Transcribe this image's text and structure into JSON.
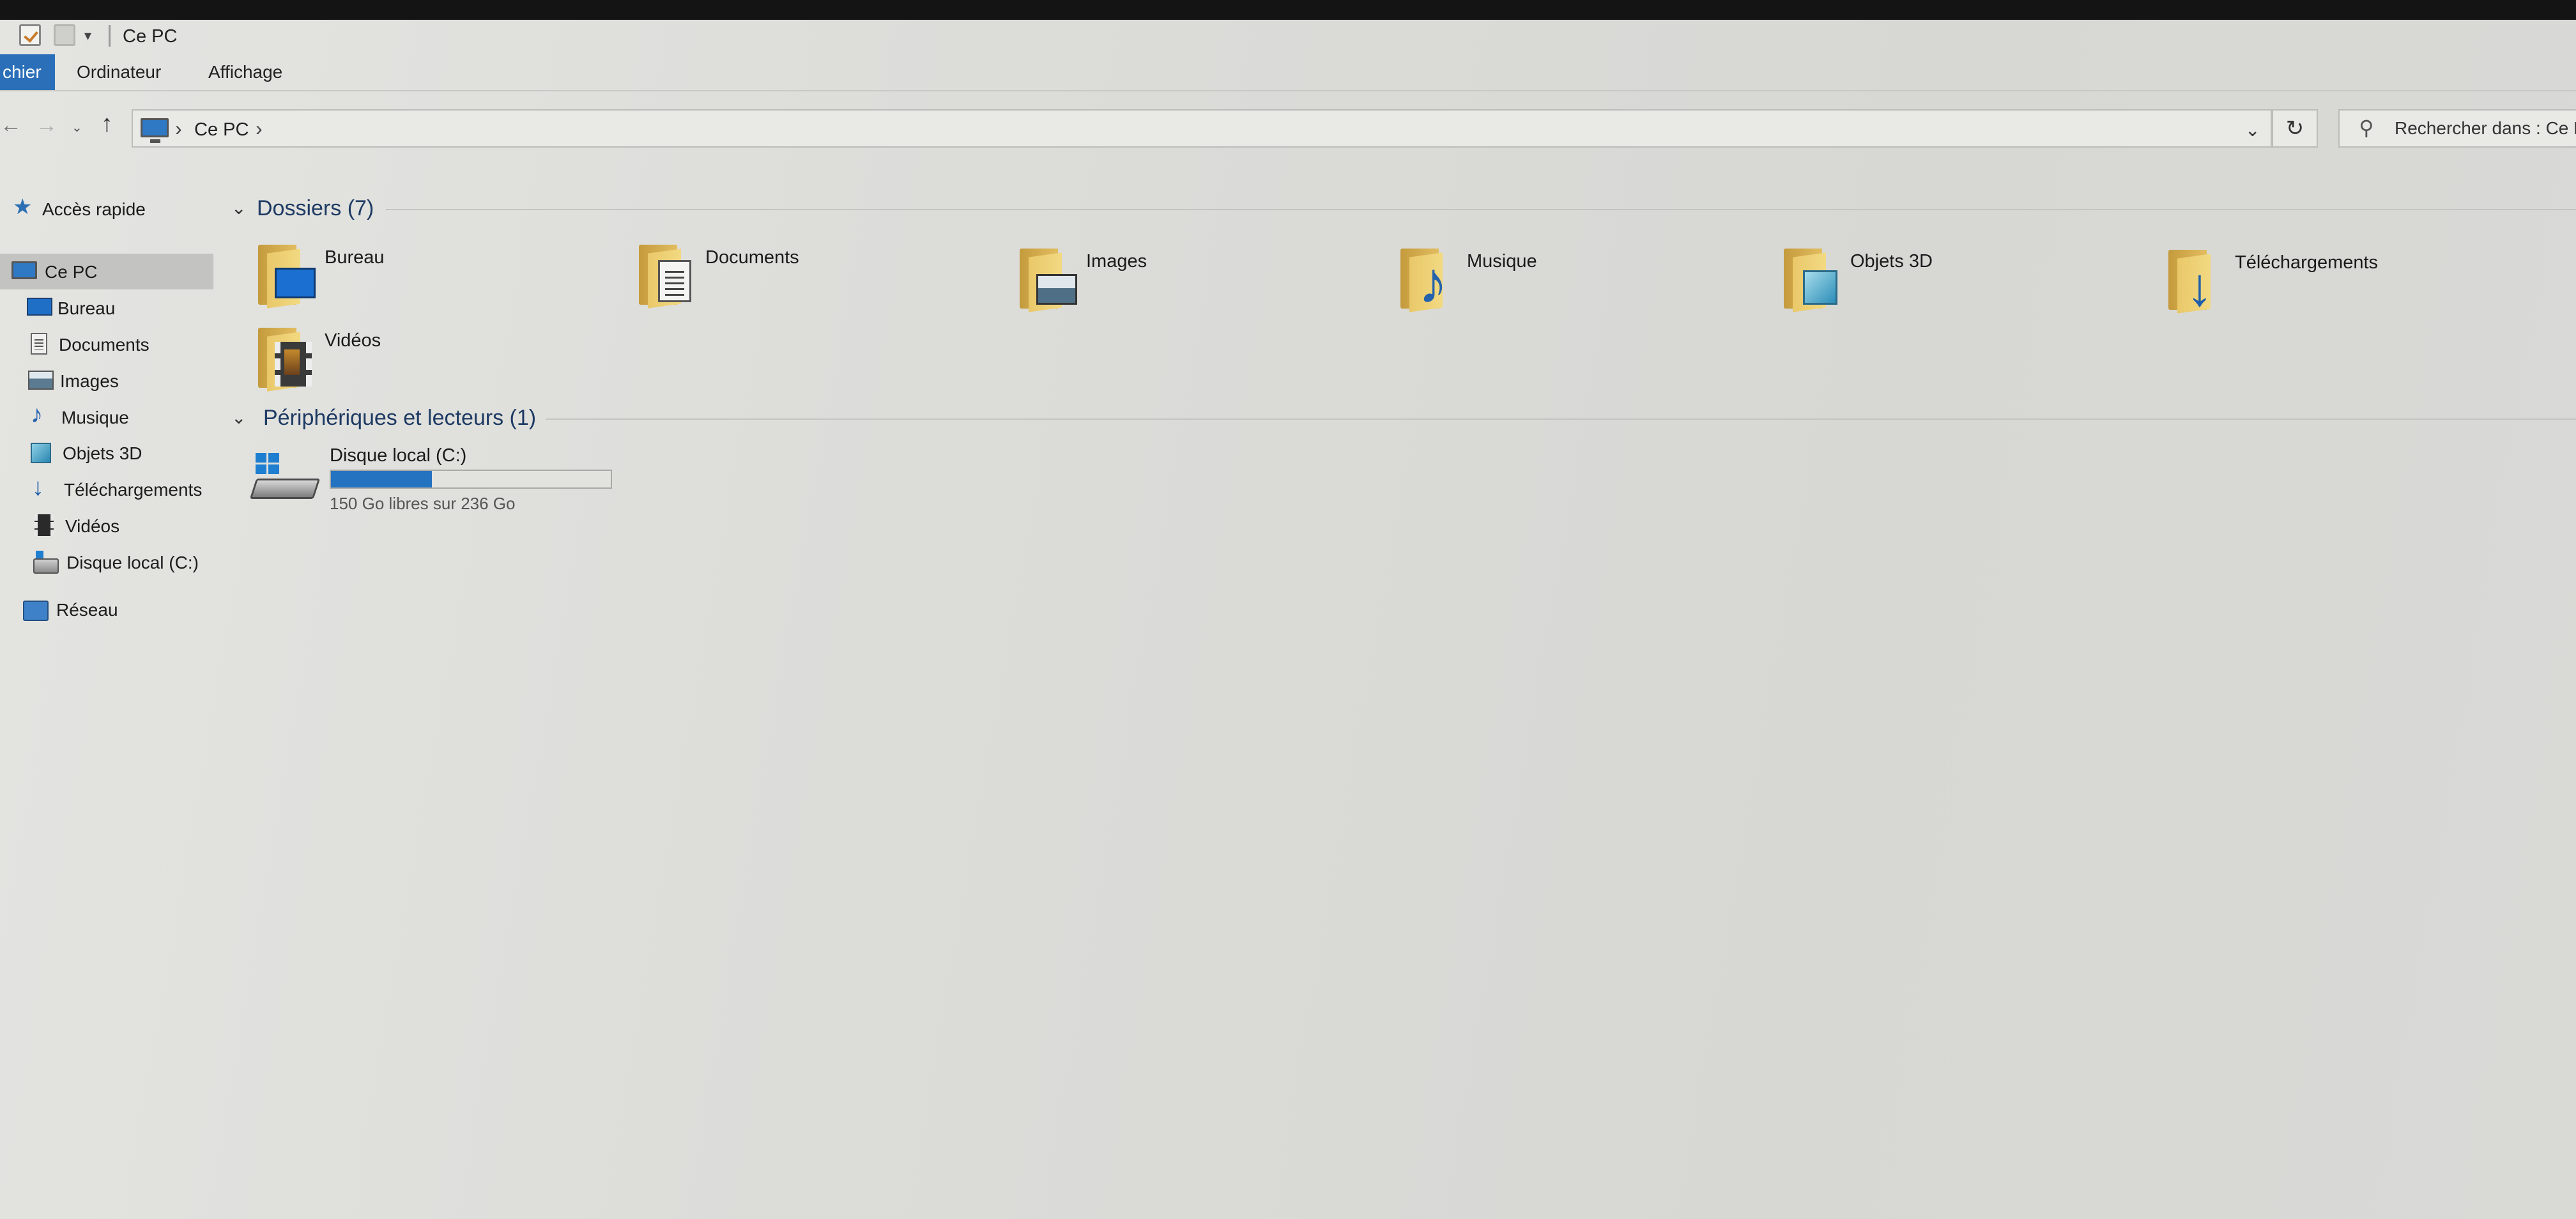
{
  "window": {
    "title": "Ce PC"
  },
  "ribbon": {
    "tabs": [
      {
        "label": "chier",
        "active": true
      },
      {
        "label": "Ordinateur",
        "active": false
      },
      {
        "label": "Affichage",
        "active": false
      }
    ]
  },
  "nav": {
    "back_icon": "back-arrow",
    "forward_icon": "forward-arrow",
    "recent_icon": "chevron-down",
    "up_icon": "up-arrow"
  },
  "address": {
    "path": "Ce PC",
    "refresh_icon": "refresh",
    "dropdown_icon": "chevron-down"
  },
  "search": {
    "placeholder": "Rechercher dans : Ce PC"
  },
  "sidebar": {
    "items": [
      {
        "label": "Accès rapide",
        "icon": "star"
      },
      {
        "label": "Ce PC",
        "icon": "computer",
        "selected": true
      },
      {
        "label": "Bureau",
        "icon": "desktop"
      },
      {
        "label": "Documents",
        "icon": "document"
      },
      {
        "label": "Images",
        "icon": "picture"
      },
      {
        "label": "Musique",
        "icon": "music-note"
      },
      {
        "label": "Objets 3D",
        "icon": "cube"
      },
      {
        "label": "Téléchargements",
        "icon": "download-arrow"
      },
      {
        "label": "Vidéos",
        "icon": "film"
      },
      {
        "label": "Disque local (C:)",
        "icon": "drive"
      },
      {
        "label": "Réseau",
        "icon": "network"
      }
    ]
  },
  "folders_group": {
    "title": "Dossiers (7)",
    "items": [
      {
        "label": "Bureau",
        "icon": "desktop-folder"
      },
      {
        "label": "Documents",
        "icon": "documents-folder"
      },
      {
        "label": "Images",
        "icon": "pictures-folder"
      },
      {
        "label": "Musique",
        "icon": "music-folder"
      },
      {
        "label": "Objets 3D",
        "icon": "3d-objects-folder"
      },
      {
        "label": "Téléchargements",
        "icon": "downloads-folder"
      },
      {
        "label": "Vidéos",
        "icon": "videos-folder"
      }
    ]
  },
  "drives_group": {
    "title": "Périphériques et lecteurs (1)",
    "items": [
      {
        "label": "Disque local (C:)",
        "free_text": "150 Go libres sur 236 Go",
        "used_fraction": 0.36,
        "accent": "#2373c1"
      }
    ]
  },
  "colors": {
    "accent": "#2a6fb8",
    "selection": "#c3c4c1",
    "group_title": "#1d3a63"
  }
}
